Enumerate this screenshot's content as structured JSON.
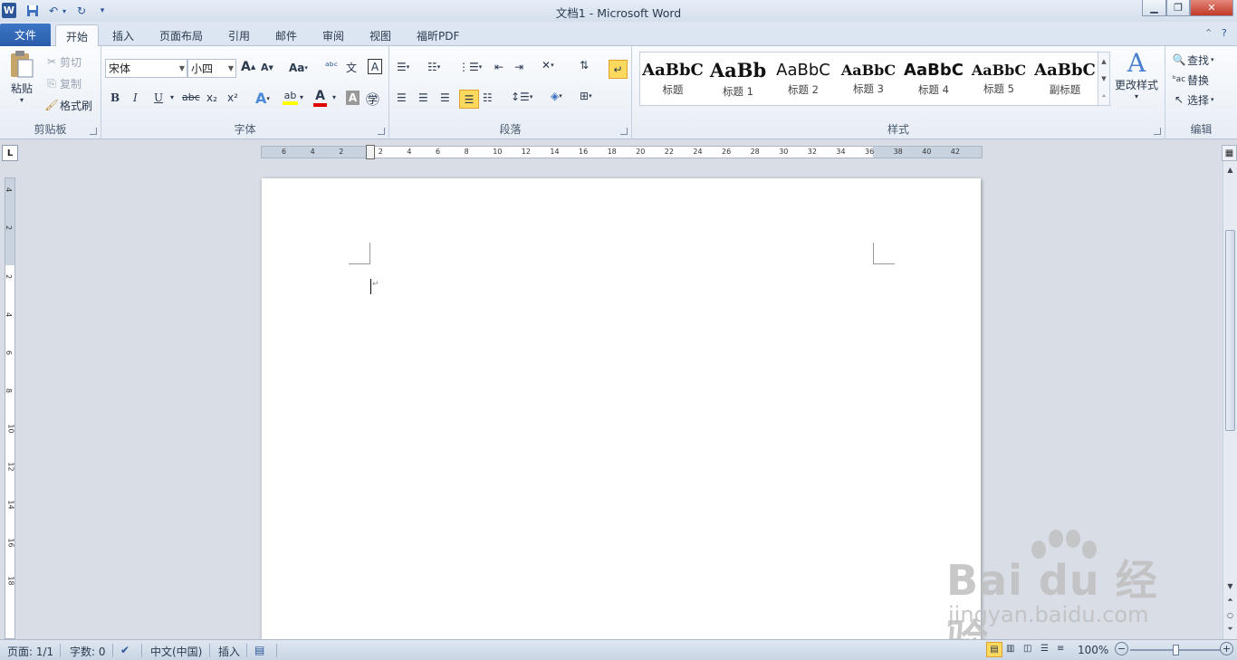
{
  "window": {
    "title": "文档1  -  Microsoft Word",
    "app_logo": "W",
    "qat": {
      "save_icon": "save-icon",
      "undo_icon": "undo-icon",
      "redo_icon": "redo-icon",
      "customize_icon": "customize-qat-icon"
    },
    "controls": {
      "minimize": "▁",
      "restore": "❐",
      "close": "✕"
    }
  },
  "tabs": [
    "文件",
    "开始",
    "插入",
    "页面布局",
    "引用",
    "邮件",
    "审阅",
    "视图",
    "福昕PDF"
  ],
  "active_tab": "开始",
  "clipboard": {
    "label": "剪贴板",
    "paste": "粘贴",
    "cut": "剪切",
    "copy": "复制",
    "format_painter": "格式刷"
  },
  "font": {
    "label": "字体",
    "name": "宋体",
    "size": "小四",
    "grow": "A",
    "shrink": "A",
    "change_case": "Aa",
    "bold": "B",
    "italic": "I",
    "underline": "U",
    "strikethrough": "abc",
    "subscript": "x₂",
    "superscript": "x²",
    "font_color": "#e00000",
    "highlight_color": "#ffff00"
  },
  "paragraph": {
    "label": "段落"
  },
  "styles": {
    "label": "样式",
    "items": [
      {
        "sample": "AaBbC",
        "name": "标题"
      },
      {
        "sample": "AaBb",
        "name": "标题 1"
      },
      {
        "sample": "AaBbC",
        "name": "标题 2"
      },
      {
        "sample": "AaBbC",
        "name": "标题 3"
      },
      {
        "sample": "AaBbC",
        "name": "标题 4"
      },
      {
        "sample": "AaBbC",
        "name": "标题 5"
      },
      {
        "sample": "AaBbC",
        "name": "副标题"
      }
    ],
    "change_styles": "更改样式"
  },
  "editing": {
    "label": "编辑",
    "find": "查找",
    "replace": "替换",
    "select": "选择"
  },
  "hruler_numbers": [
    "6",
    "4",
    "2",
    "2",
    "4",
    "6",
    "8",
    "10",
    "12",
    "14",
    "16",
    "18",
    "20",
    "22",
    "24",
    "26",
    "28",
    "30",
    "32",
    "34",
    "36",
    "38",
    "40",
    "42"
  ],
  "vruler_numbers": [
    "4",
    "2",
    "2",
    "4",
    "6",
    "8",
    "10",
    "12",
    "14",
    "16",
    "18"
  ],
  "status": {
    "page": "页面: 1/1",
    "words": "字数: 0",
    "language": "中文(中国)",
    "mode": "插入",
    "zoom": "100%",
    "zoom_level": 1.0
  },
  "watermark": {
    "main": "Bai du 经验",
    "sub": "jingyan.baidu.com"
  }
}
